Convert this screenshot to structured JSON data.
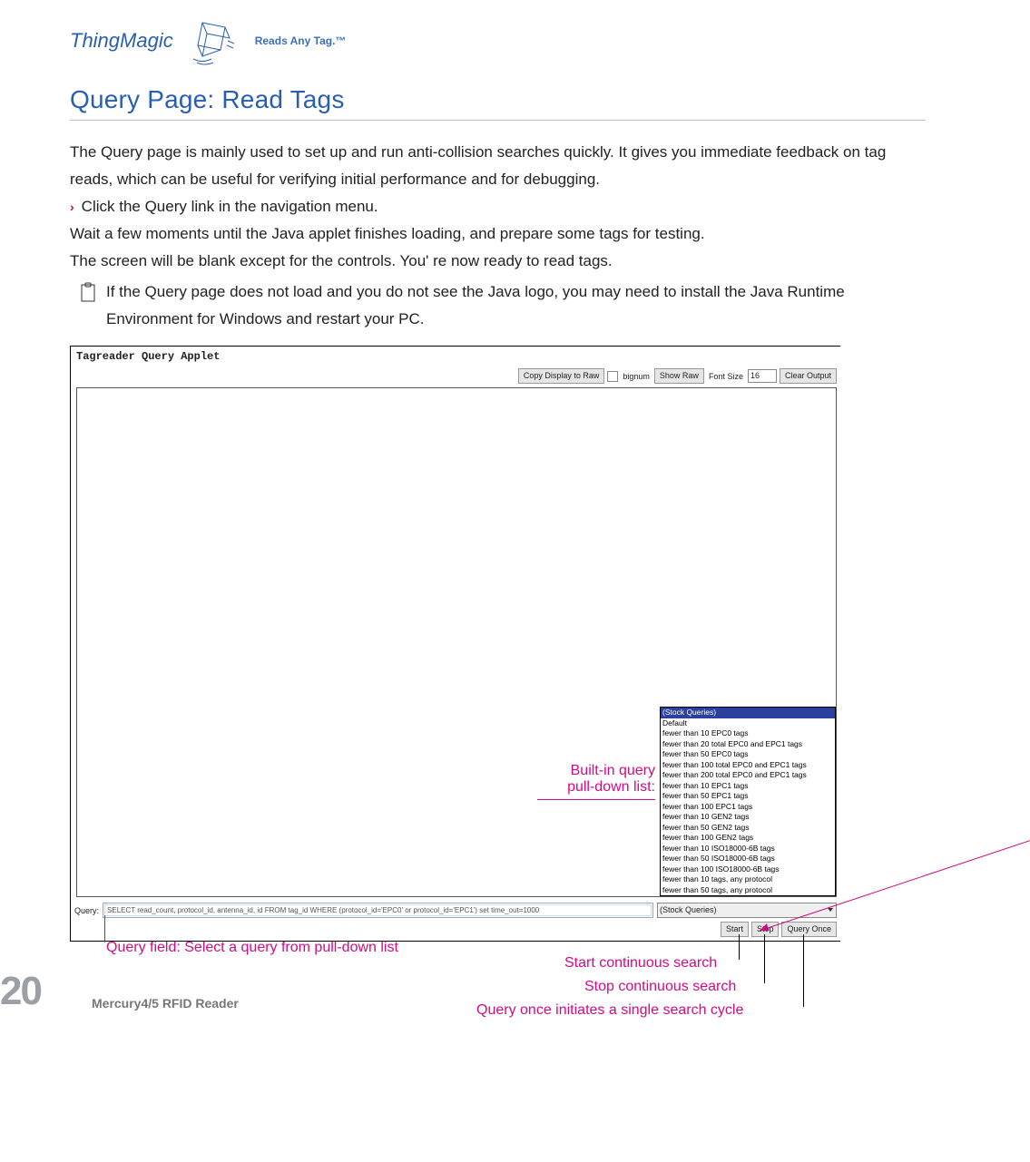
{
  "header": {
    "brand": "ThingMagic",
    "tagline": "Reads Any Tag.™"
  },
  "title": "Query Page: Read Tags",
  "paragraphs": {
    "p1": "The Query page is mainly used to set up and run anti-collision searches quickly. It gives you immediate feedback on tag reads, which can be useful for verifying initial performance and for debugging.",
    "bullet1": "Click the Query link in the navigation menu.",
    "p2": "Wait a few moments until the Java applet finishes loading, and prepare some tags for testing.",
    "p3": "The screen will be blank except for the controls. You' re now ready to read tags.",
    "note": "If the Query page does not load and you do not see the Java logo, you may need to install the Java Runtime Environment for Windows and restart your PC."
  },
  "applet": {
    "title": "Tagreader Query Applet",
    "toolbar": {
      "copy": "Copy Display to Raw",
      "bignum": "bignum",
      "show_raw": "Show Raw",
      "font_label": "Font Size",
      "font_value": "16",
      "clear": "Clear Output"
    },
    "dropdown_header": "(Stock Queries)",
    "dropdown_options": [
      "Default",
      "fewer than 10 EPC0 tags",
      "fewer than 20 total EPC0 and EPC1 tags",
      "fewer than 50 EPC0 tags",
      "fewer than 100 total EPC0 and EPC1 tags",
      "fewer than 200 total EPC0 and EPC1 tags",
      "fewer than 10 EPC1 tags",
      "fewer than 50 EPC1 tags",
      "fewer than 100 EPC1 tags",
      "fewer than 10 GEN2 tags",
      "fewer than 50 GEN2 tags",
      "fewer than 100 GEN2 tags",
      "fewer than 10 ISO18000-6B tags",
      "fewer than 50 ISO18000-6B tags",
      "fewer than 100 ISO18000-6B tags",
      "fewer than 10 tags, any protocol",
      "fewer than 50 tags, any protocol"
    ],
    "query_label": "Query:",
    "query_value": "SELECT read_count, protocol_id, antenna_id, id FROM tag_id WHERE (protocol_id='EPC0' or protocol_id='EPC1') set time_out=1000",
    "stock_selected": "(Stock Queries)",
    "start": "Start",
    "stop": "Stop",
    "query_once": "Query Once"
  },
  "callouts": {
    "builtin1": "Built-in query",
    "builtin2": "pull-down list:",
    "queryfield": "Query field: Select a query from pull-down list",
    "start": "Start continuous search",
    "stop": "Stop continuous search",
    "once": "Query once initiates a single search cycle"
  },
  "footer": {
    "page": "20",
    "label": "Mercury4/5 RFID Reader"
  }
}
